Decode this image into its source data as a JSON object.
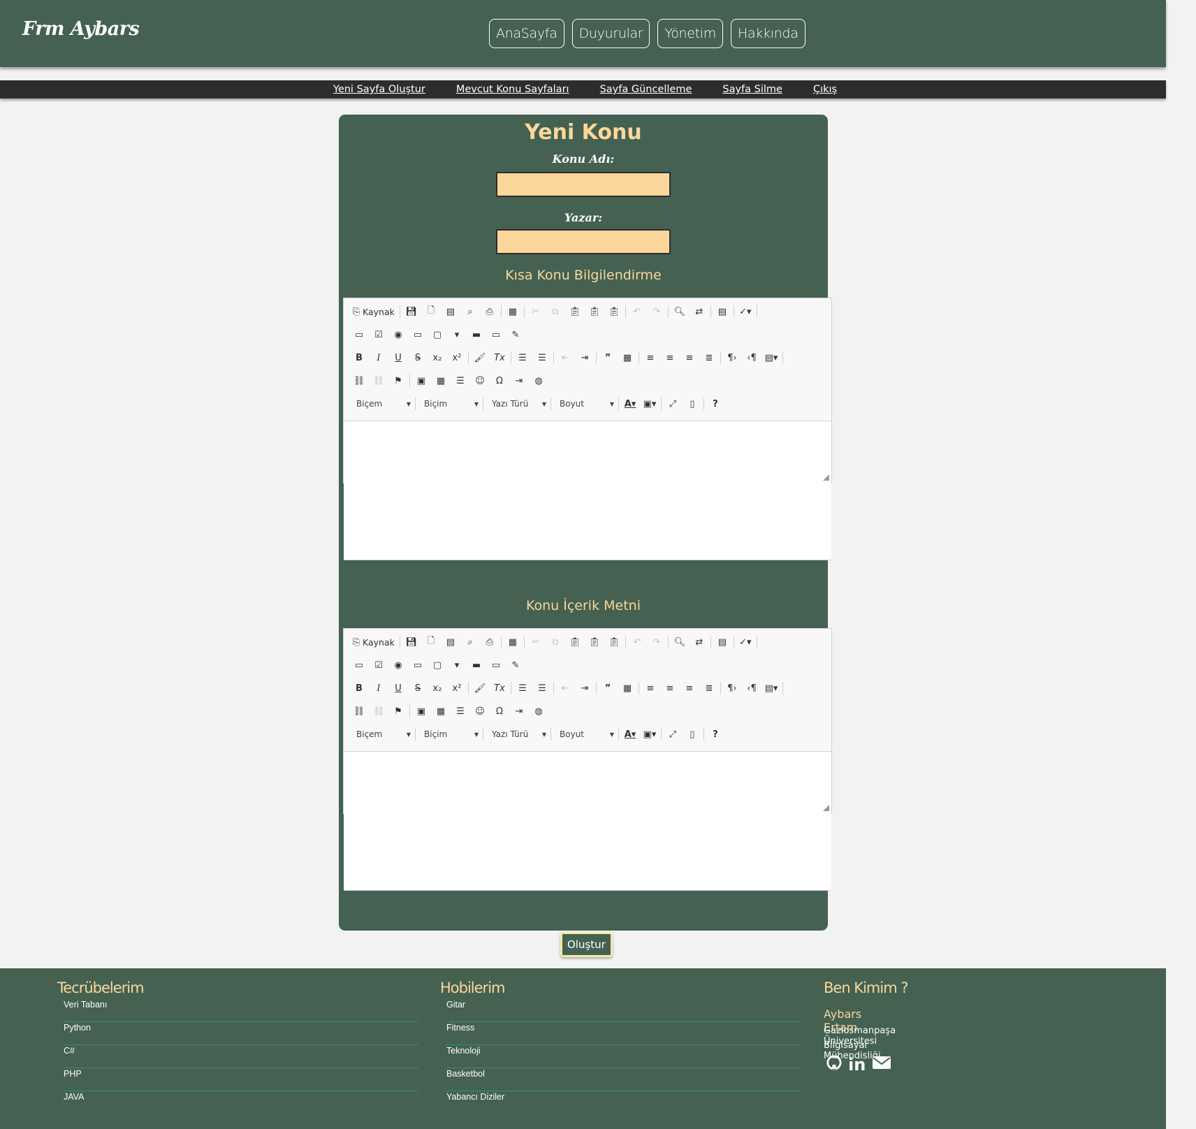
{
  "header": {
    "logo": "Frm Aybars",
    "nav": [
      "AnaSayfa",
      "Duyurular",
      "Yönetim",
      "Hakkında"
    ]
  },
  "subnav": [
    "Yeni Sayfa Oluştur",
    "Mevcut Konu Sayfaları",
    "Sayfa Güncelleme",
    "Sayfa Silme",
    "Çıkış"
  ],
  "form": {
    "title": "Yeni Konu",
    "topic_label": "Konu Adı:",
    "topic_value": "",
    "author_label": "Yazar:",
    "author_value": "",
    "summary_title": "Kısa Konu Bilgilendirme",
    "content_title": "Konu İçerik Metni",
    "submit_label": "Oluştur"
  },
  "editor": {
    "source_label": "Kaynak",
    "combos": [
      "Biçem",
      "Biçim",
      "Yazı Türü",
      "Boyut"
    ]
  },
  "footer": {
    "experience": {
      "title": "Tecrübelerim",
      "items": [
        "Veri Tabanı",
        "Python",
        "C#",
        "PHP",
        "JAVA"
      ]
    },
    "hobbies": {
      "title": "Hobilerim",
      "items": [
        "Gitar",
        "Fitness",
        "Teknoloji",
        "Basketbol",
        "Yabancı Diziler"
      ]
    },
    "about": {
      "title": "Ben Kimim ?",
      "name": "Aybars Ertam",
      "line1": "Gaziosmanpaşa Üniversitesi",
      "line2": "Bilgisayar Mühendisliği",
      "icons": [
        "github-icon",
        "linkedin-icon",
        "envelope-icon"
      ]
    }
  },
  "colors": {
    "primary": "#446151",
    "accent": "#fbd79b",
    "subnav": "#2c2e2d"
  }
}
